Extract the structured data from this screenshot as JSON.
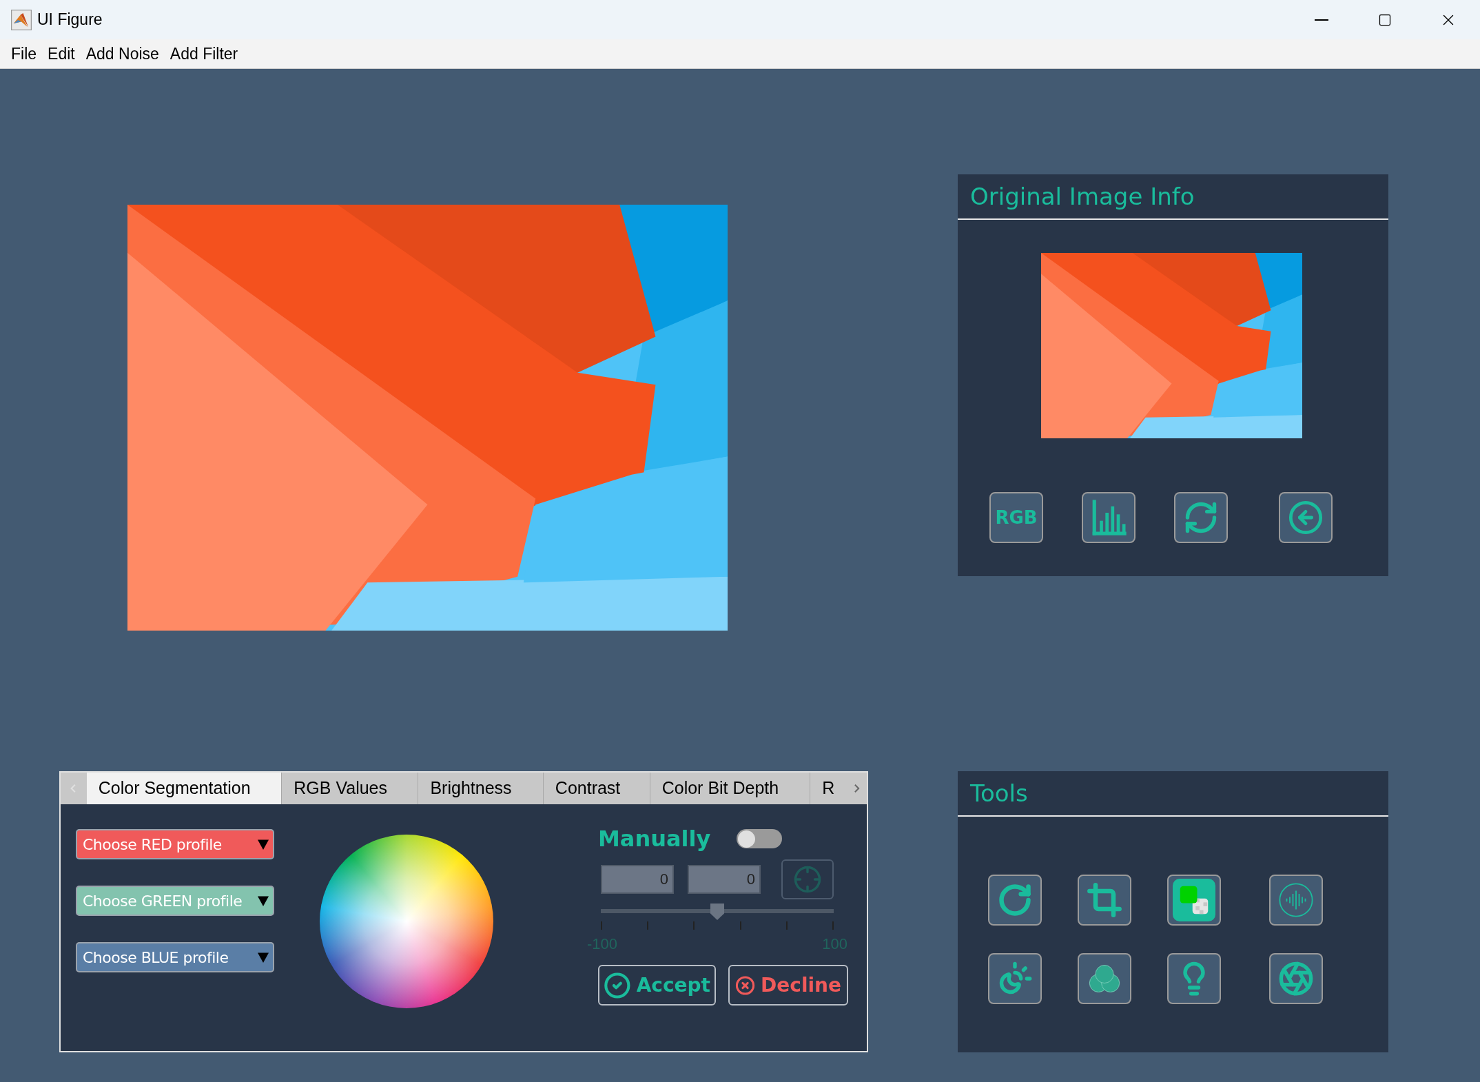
{
  "window": {
    "title": "UI Figure"
  },
  "menu": [
    "File",
    "Edit",
    "Add Noise",
    "Add Filter"
  ],
  "tab_panel": {
    "tabs": [
      {
        "label": "Color Segmentation",
        "selected": true
      },
      {
        "label": "RGB Values",
        "selected": false
      },
      {
        "label": "Brightness",
        "selected": false
      },
      {
        "label": "Contrast",
        "selected": false
      },
      {
        "label": "Color Bit Depth",
        "selected": false
      },
      {
        "label": "R",
        "selected": false
      }
    ],
    "dropdowns": [
      {
        "label": "Choose RED profile",
        "color": "#f05a5a"
      },
      {
        "label": "Choose GREEN profile",
        "color": "#83c3ae"
      },
      {
        "label": "Choose BLUE profile",
        "color": "#5a7ea6"
      }
    ],
    "manual": {
      "label": "Manually",
      "on": false
    },
    "fields": [
      "0",
      "0"
    ],
    "slider": {
      "level": 0.5,
      "min_label": "-100",
      "max_label": "100"
    },
    "accept": "Accept",
    "decline": "Decline"
  },
  "info_panel": {
    "title": "Original Image Info",
    "buttons": [
      {
        "kind": "text",
        "label": "RGB"
      },
      {
        "kind": "histogram"
      },
      {
        "kind": "refresh"
      },
      {
        "kind": "back"
      }
    ]
  },
  "tools_panel": {
    "title": "Tools",
    "tools": [
      {
        "kind": "rotate",
        "selected": false
      },
      {
        "kind": "crop",
        "selected": false
      },
      {
        "kind": "background",
        "selected": true
      },
      {
        "kind": "audio",
        "selected": false
      },
      {
        "kind": "contrast",
        "selected": false
      },
      {
        "kind": "channels",
        "selected": false
      },
      {
        "kind": "bulb",
        "selected": false
      },
      {
        "kind": "aperture",
        "selected": false
      }
    ]
  }
}
